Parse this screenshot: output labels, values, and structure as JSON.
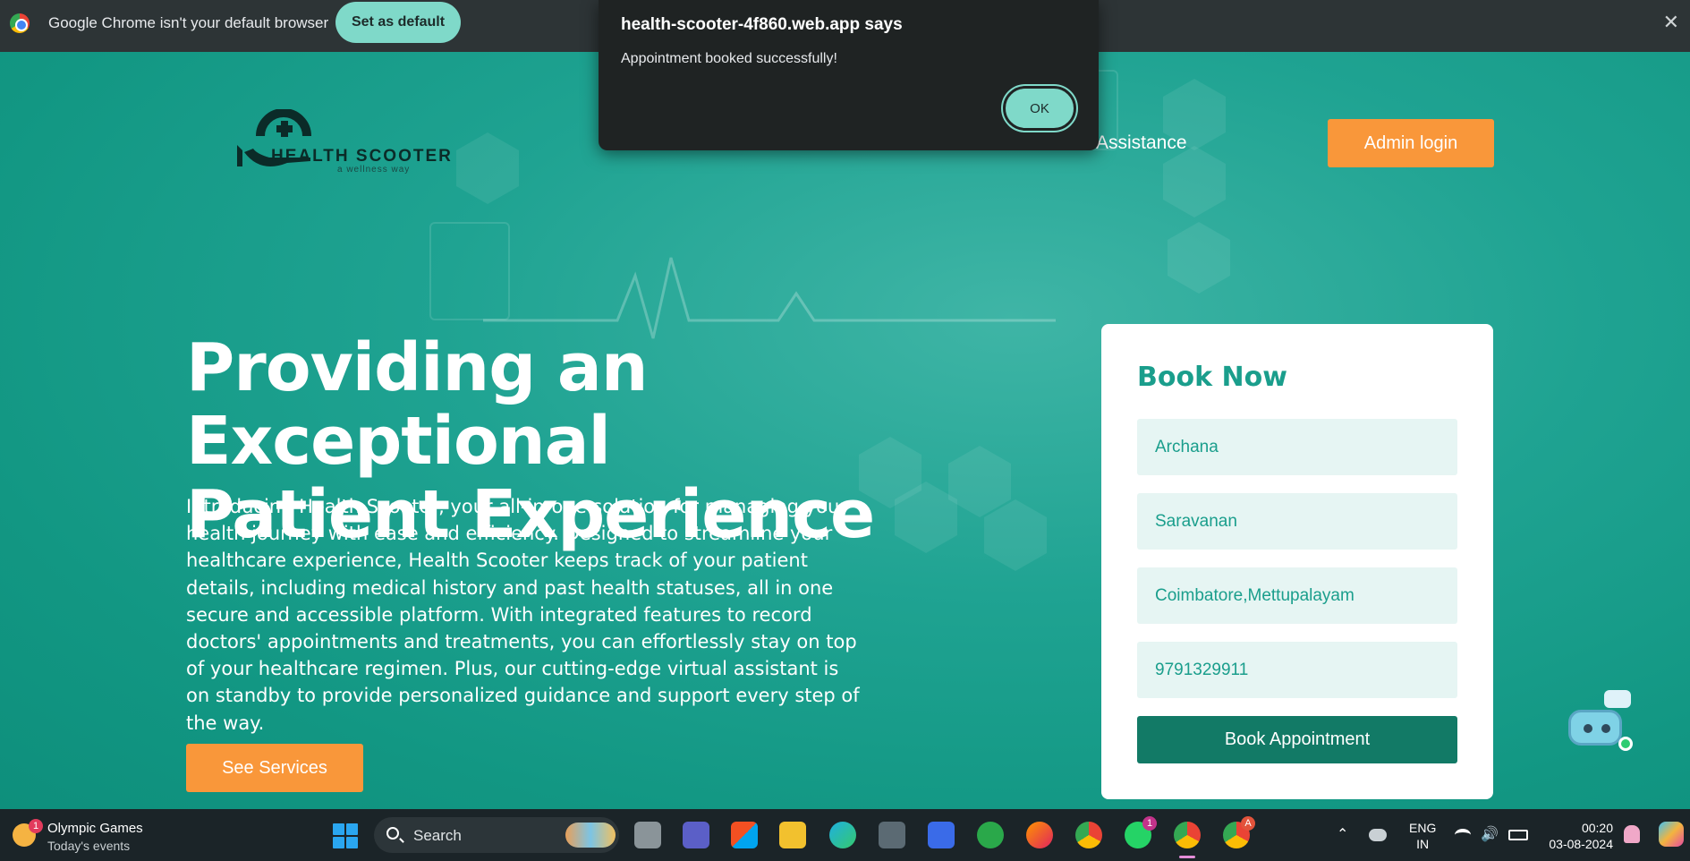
{
  "browser_infobar": {
    "message": "Google Chrome isn't your default browser",
    "set_default_label": "Set as default",
    "close_label": "✕"
  },
  "dialog": {
    "origin": "health-scooter-4f860.web.app says",
    "message": "Appointment booked successfully!",
    "ok_label": "OK"
  },
  "header": {
    "brand": "HEALTH SCOOTER",
    "tagline": "a wellness way",
    "nav_assistance": "Assistance",
    "admin_login_label": "Admin login"
  },
  "hero": {
    "headline_line1": "Providing an Exceptional",
    "headline_line2": "Patient Experience",
    "intro": "Introducing Health Scooter, your all-in-one solution for managing your health journey with ease and efficiency. Designed to streamline your healthcare experience, Health Scooter keeps track of your patient details, including medical history and past health statuses, all in one secure and accessible platform. With integrated features to record doctors' appointments and treatments, you can effortlessly stay on top of your healthcare regimen. Plus, our cutting-edge virtual assistant is on standby to provide personalized guidance and support every step of the way.",
    "see_services_label": "See Services"
  },
  "book_form": {
    "title": "Book Now",
    "first_name": "Archana",
    "last_name": "Saravanan",
    "address": "Coimbatore,Mettupalayam",
    "phone": "9791329911",
    "submit_label": "Book Appointment"
  },
  "taskbar": {
    "weather_title": "Olympic Games",
    "weather_subtitle": "Today's events",
    "weather_badge": "1",
    "search_label": "Search",
    "whatsapp_badge": "1",
    "chrome_badge": "A",
    "language_line1": "ENG",
    "language_line2": "IN",
    "time": "00:20",
    "date": "03-08-2024"
  },
  "colors": {
    "accent_teal": "#1a9e8c",
    "button_orange": "#f9973a",
    "book_button": "#127a66",
    "dialog_bg": "#1f2323",
    "infobar_bg": "#2d3436"
  }
}
